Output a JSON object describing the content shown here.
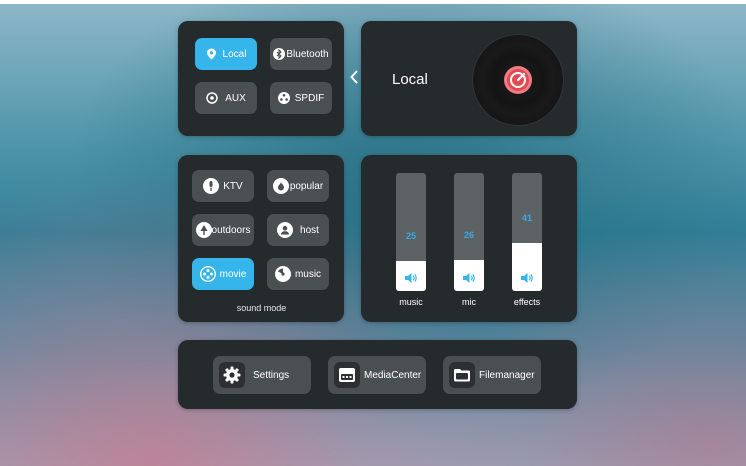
{
  "source": {
    "buttons": [
      {
        "label": "Local",
        "icon": "location-pin-icon",
        "active": true
      },
      {
        "label": "Bluetooth",
        "icon": "bluetooth-icon",
        "active": false
      },
      {
        "label": "AUX",
        "icon": "aux-ring-icon",
        "active": false
      },
      {
        "label": "SPDIF",
        "icon": "spdif-icon",
        "active": false
      }
    ],
    "current": "Local"
  },
  "sound_mode": {
    "title": "sound mode",
    "buttons": [
      {
        "label": "KTV",
        "icon": "microphone-icon",
        "active": false
      },
      {
        "label": "popular",
        "icon": "flame-icon",
        "active": false
      },
      {
        "label": "outdoors",
        "icon": "tree-icon",
        "active": false
      },
      {
        "label": "host",
        "icon": "host-person-icon",
        "active": false
      },
      {
        "label": "movie",
        "icon": "film-reel-icon",
        "active": true
      },
      {
        "label": "music",
        "icon": "music-disc-icon",
        "active": false
      }
    ]
  },
  "volumes": [
    {
      "label": "music",
      "value": "25",
      "level": 0.25
    },
    {
      "label": "mic",
      "value": "26",
      "level": 0.26
    },
    {
      "label": "effects",
      "value": "41",
      "level": 0.41
    }
  ],
  "apps": [
    {
      "label": "Settings",
      "icon": "gear-icon"
    },
    {
      "label": "MediaCenter",
      "icon": "media-center-icon"
    },
    {
      "label": "Filemanager",
      "icon": "folder-icon"
    }
  ],
  "colors": {
    "accent": "#35b5ea",
    "panel": "#252a2d",
    "button": "#4a4f52",
    "value_text": "#3aa9e2"
  }
}
